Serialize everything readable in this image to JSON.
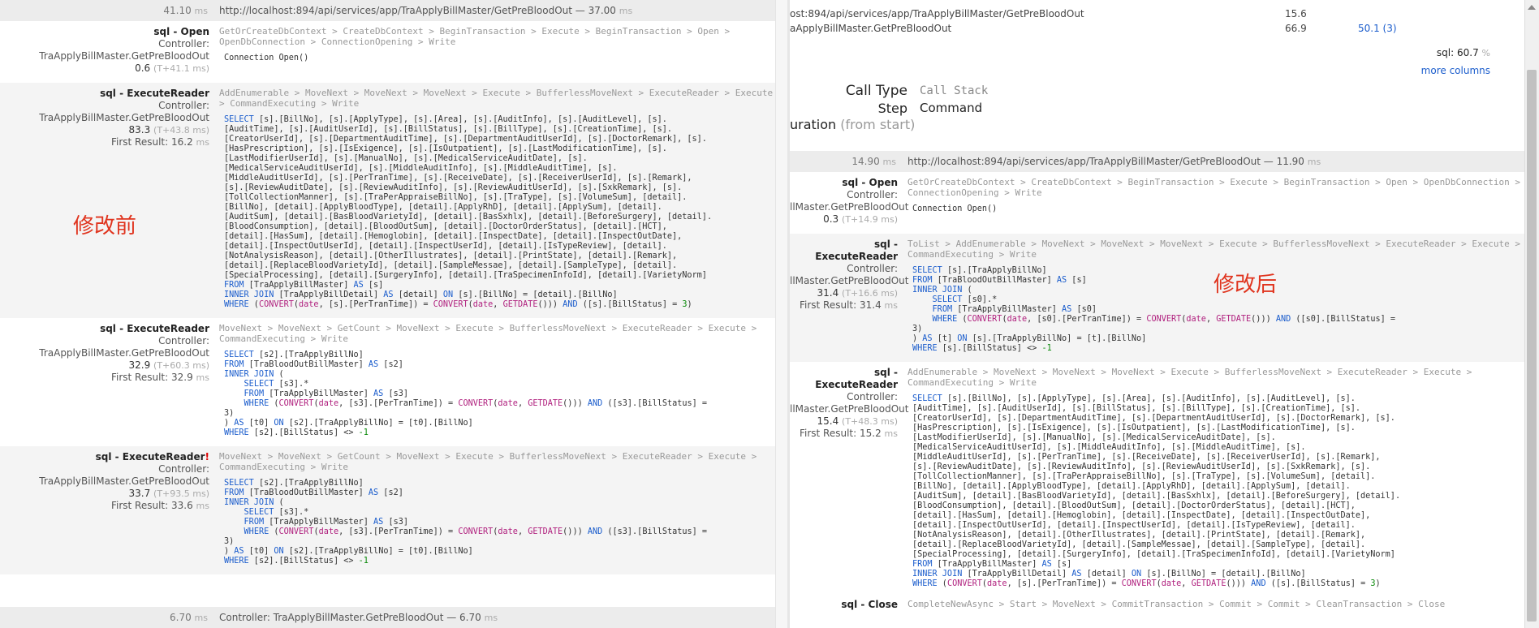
{
  "left": {
    "header": {
      "duration": "41.10",
      "unit": "ms",
      "url": "http://localhost:894/api/services/app/TraApplyBillMaster/GetPreBloodOut",
      "url_suffix": " — 37.00",
      "url_unit": "ms"
    },
    "annotation": "修改前",
    "entries": [
      {
        "type": "sql - Open",
        "flag": "",
        "controller_label": "Controller:",
        "controller": "TraApplyBillMaster.GetPreBloodOut",
        "timing": "0.6",
        "timing_rel": "(T+41.1 ms)",
        "first_result": "",
        "stack": "GetOrCreateDbContext > CreateDbContext > BeginTransaction > Execute > BeginTransaction > Open > OpenDbConnection > ConnectionOpening > Write",
        "sql": "Connection Open()"
      },
      {
        "type": "sql - ExecuteReader",
        "flag": "",
        "controller_label": "Controller:",
        "controller": "TraApplyBillMaster.GetPreBloodOut",
        "timing": "83.3",
        "timing_rel": "(T+43.8 ms)",
        "first_result": "First Result: 16.2",
        "stack": "AddEnumerable > MoveNext > MoveNext > MoveNext > Execute > BufferlessMoveNext > ExecuteReader > Execute > CommandExecuting > Write",
        "sql": "SELECT [s].[BillNo], [s].[ApplyType], [s].[Area], [s].[AuditInfo], [s].[AuditLevel], [s].\n[AuditTime], [s].[AuditUserId], [s].[BillStatus], [s].[BillType], [s].[CreationTime], [s].\n[CreatorUserId], [s].[DepartmentAuditTime], [s].[DepartmentAuditUserId], [s].[DoctorRemark], [s].\n[HasPrescription], [s].[IsExigence], [s].[IsOutpatient], [s].[LastModificationTime], [s].\n[LastModifierUserId], [s].[ManualNo], [s].[MedicalServiceAuditDate], [s].\n[MedicalServiceAuditUserId], [s].[MiddleAuditInfo], [s].[MiddleAuditTime], [s].\n[MiddleAuditUserId], [s].[PerTranTime], [s].[ReceiveDate], [s].[ReceiverUserId], [s].[Remark],\n[s].[ReviewAuditDate], [s].[ReviewAuditInfo], [s].[ReviewAuditUserId], [s].[SxkRemark], [s].\n[TollCollectionManner], [s].[TraPerAppraiseBillNo], [s].[TraType], [s].[VolumeSum], [detail].\n[BillNo], [detail].[ApplyBloodType], [detail].[ApplyRhD], [detail].[ApplySum], [detail].\n[AuditSum], [detail].[BasBloodVarietyId], [detail].[BasSxhlx], [detail].[BeforeSurgery], [detail].\n[BloodConsumption], [detail].[BloodOutSum], [detail].[DoctorOrderStatus], [detail].[HCT],\n[detail].[HasSum], [detail].[Hemoglobin], [detail].[InspectDate], [detail].[InspectOutDate],\n[detail].[InspectOutUserId], [detail].[InspectUserId], [detail].[IsTypeReview], [detail].\n[NotAnalysisReason], [detail].[OtherIllustrates], [detail].[PrintState], [detail].[Remark],\n[detail].[ReplaceBloodVarietyId], [detail].[SampleMessae], [detail].[SampleType], [detail].\n[SpecialProcessing], [detail].[SurgeryInfo], [detail].[TraSpecimenInfoId], [detail].[VarietyNorm]\nFROM [TraApplyBillMaster] AS [s]\nINNER JOIN [TraApplyBillDetail] AS [detail] ON [s].[BillNo] = [detail].[BillNo]\nWHERE (CONVERT(date, [s].[PerTranTime]) = CONVERT(date, GETDATE())) AND ([s].[BillStatus] = 3)"
      },
      {
        "type": "sql - ExecuteReader",
        "flag": "",
        "controller_label": "Controller:",
        "controller": "TraApplyBillMaster.GetPreBloodOut",
        "timing": "32.9",
        "timing_rel": "(T+60.3 ms)",
        "first_result": "First Result: 32.9",
        "stack": "MoveNext > MoveNext > GetCount > MoveNext > Execute > BufferlessMoveNext > ExecuteReader > Execute > CommandExecuting > Write",
        "sql": "SELECT [s2].[TraApplyBillNo]\nFROM [TraBloodOutBillMaster] AS [s2]\nINNER JOIN (\n    SELECT [s3].*\n    FROM [TraApplyBillMaster] AS [s3]\n    WHERE (CONVERT(date, [s3].[PerTranTime]) = CONVERT(date, GETDATE())) AND ([s3].[BillStatus] =\n3)\n) AS [t0] ON [s2].[TraApplyBillNo] = [t0].[BillNo]\nWHERE [s2].[BillStatus] <> -1"
      },
      {
        "type": "sql - ExecuteReader",
        "flag": "!",
        "controller_label": "Controller:",
        "controller": "TraApplyBillMaster.GetPreBloodOut",
        "timing": "33.7",
        "timing_rel": "(T+93.5 ms)",
        "first_result": "First Result: 33.6",
        "stack": "MoveNext > MoveNext > GetCount > MoveNext > Execute > BufferlessMoveNext > ExecuteReader > Execute > CommandExecuting > Write",
        "sql": "SELECT [s2].[TraApplyBillNo]\nFROM [TraBloodOutBillMaster] AS [s2]\nINNER JOIN (\n    SELECT [s3].*\n    FROM [TraApplyBillMaster] AS [s3]\n    WHERE (CONVERT(date, [s3].[PerTranTime]) = CONVERT(date, GETDATE())) AND ([s3].[BillStatus] =\n3)\n) AS [t0] ON [s2].[TraApplyBillNo] = [t0].[BillNo]\nWHERE [s2].[BillStatus] <> -1"
      }
    ],
    "footer": {
      "duration": "6.70",
      "unit": "ms",
      "text": "Controller: TraApplyBillMaster.GetPreBloodOut — 6.70",
      "text_unit": "ms"
    }
  },
  "right": {
    "top": {
      "line1": "ost:894/api/services/app/TraApplyBillMaster/GetPreBloodOut",
      "line2": "aApplyBillMaster.GetPreBloodOut",
      "v1": "15.6",
      "v2": "66.9",
      "v3": "50.1 (3)",
      "sql_label": "sql:",
      "sql_pct": "60.7",
      "sql_pct_unit": "%",
      "more_columns": "more columns"
    },
    "call": {
      "call_type_label": "Call Type",
      "step_label": "Step",
      "duration_label": "uration",
      "duration_suffix": "(from start)",
      "call_stack": "Call Stack",
      "command": "Command"
    },
    "header": {
      "duration": "14.90",
      "unit": "ms",
      "url": "http://localhost:894/api/services/app/TraApplyBillMaster/GetPreBloodOut",
      "url_suffix": " — 11.90",
      "url_unit": "ms"
    },
    "annotation": "修改后",
    "entries": [
      {
        "type": "sql - Open",
        "flag": "",
        "controller_label": "Controller:",
        "controller": "llMaster.GetPreBloodOut",
        "timing": "0.3",
        "timing_rel": "(T+14.9 ms)",
        "first_result": "",
        "stack": "GetOrCreateDbContext > CreateDbContext > BeginTransaction > Execute > BeginTransaction > Open > OpenDbConnection > ConnectionOpening > Write",
        "sql": "Connection Open()"
      },
      {
        "type": "sql - ExecuteReader",
        "flag": "",
        "controller_label": "Controller:",
        "controller": "llMaster.GetPreBloodOut",
        "timing": "31.4",
        "timing_rel": "(T+16.6 ms)",
        "first_result": "First Result: 31.4",
        "stack": "ToList > AddEnumerable > MoveNext > MoveNext > MoveNext > Execute > BufferlessMoveNext > ExecuteReader > Execute > CommandExecuting > Write",
        "sql": "SELECT [s].[TraApplyBillNo]\nFROM [TraBloodOutBillMaster] AS [s]\nINNER JOIN (\n    SELECT [s0].*\n    FROM [TraApplyBillMaster] AS [s0]\n    WHERE (CONVERT(date, [s0].[PerTranTime]) = CONVERT(date, GETDATE())) AND ([s0].[BillStatus] =\n3)\n) AS [t] ON [s].[TraApplyBillNo] = [t].[BillNo]\nWHERE [s].[BillStatus] <> -1"
      },
      {
        "type": "sql - ExecuteReader",
        "flag": "",
        "controller_label": "Controller:",
        "controller": "llMaster.GetPreBloodOut",
        "timing": "15.4",
        "timing_rel": "(T+48.3 ms)",
        "first_result": "First Result: 15.2",
        "stack": "AddEnumerable > MoveNext > MoveNext > MoveNext > Execute > BufferlessMoveNext > ExecuteReader > Execute > CommandExecuting > Write",
        "sql": "SELECT [s].[BillNo], [s].[ApplyType], [s].[Area], [s].[AuditInfo], [s].[AuditLevel], [s].\n[AuditTime], [s].[AuditUserId], [s].[BillStatus], [s].[BillType], [s].[CreationTime], [s].\n[CreatorUserId], [s].[DepartmentAuditTime], [s].[DepartmentAuditUserId], [s].[DoctorRemark], [s].\n[HasPrescription], [s].[IsExigence], [s].[IsOutpatient], [s].[LastModificationTime], [s].\n[LastModifierUserId], [s].[ManualNo], [s].[MedicalServiceAuditDate], [s].\n[MedicalServiceAuditUserId], [s].[MiddleAuditInfo], [s].[MiddleAuditTime], [s].\n[MiddleAuditUserId], [s].[PerTranTime], [s].[ReceiveDate], [s].[ReceiverUserId], [s].[Remark],\n[s].[ReviewAuditDate], [s].[ReviewAuditInfo], [s].[ReviewAuditUserId], [s].[SxkRemark], [s].\n[TollCollectionManner], [s].[TraPerAppraiseBillNo], [s].[TraType], [s].[VolumeSum], [detail].\n[BillNo], [detail].[ApplyBloodType], [detail].[ApplyRhD], [detail].[ApplySum], [detail].\n[AuditSum], [detail].[BasBloodVarietyId], [detail].[BasSxhlx], [detail].[BeforeSurgery], [detail].\n[BloodConsumption], [detail].[BloodOutSum], [detail].[DoctorOrderStatus], [detail].[HCT],\n[detail].[HasSum], [detail].[Hemoglobin], [detail].[InspectDate], [detail].[InspectOutDate],\n[detail].[InspectOutUserId], [detail].[InspectUserId], [detail].[IsTypeReview], [detail].\n[NotAnalysisReason], [detail].[OtherIllustrates], [detail].[PrintState], [detail].[Remark],\n[detail].[ReplaceBloodVarietyId], [detail].[SampleMessae], [detail].[SampleType], [detail].\n[SpecialProcessing], [detail].[SurgeryInfo], [detail].[TraSpecimenInfoId], [detail].[VarietyNorm]\nFROM [TraApplyBillMaster] AS [s]\nINNER JOIN [TraApplyBillDetail] AS [detail] ON [s].[BillNo] = [detail].[BillNo]\nWHERE (CONVERT(date, [s].[PerTranTime]) = CONVERT(date, GETDATE())) AND ([s].[BillStatus] = 3)"
      }
    ],
    "bottom_partial": {
      "type": "sql - Close",
      "stack": "CompleteNewAsync > Start > MoveNext > CommitTransaction > Commit > Commit > CleanTransaction > Close"
    }
  },
  "colors": {
    "keyword": "#1a5ccc",
    "function": "#b0207e",
    "number": "#0a8a0a",
    "annotation": "#e0341e",
    "header_bg": "#ececec",
    "alt_bg": "#f4f4f4"
  }
}
